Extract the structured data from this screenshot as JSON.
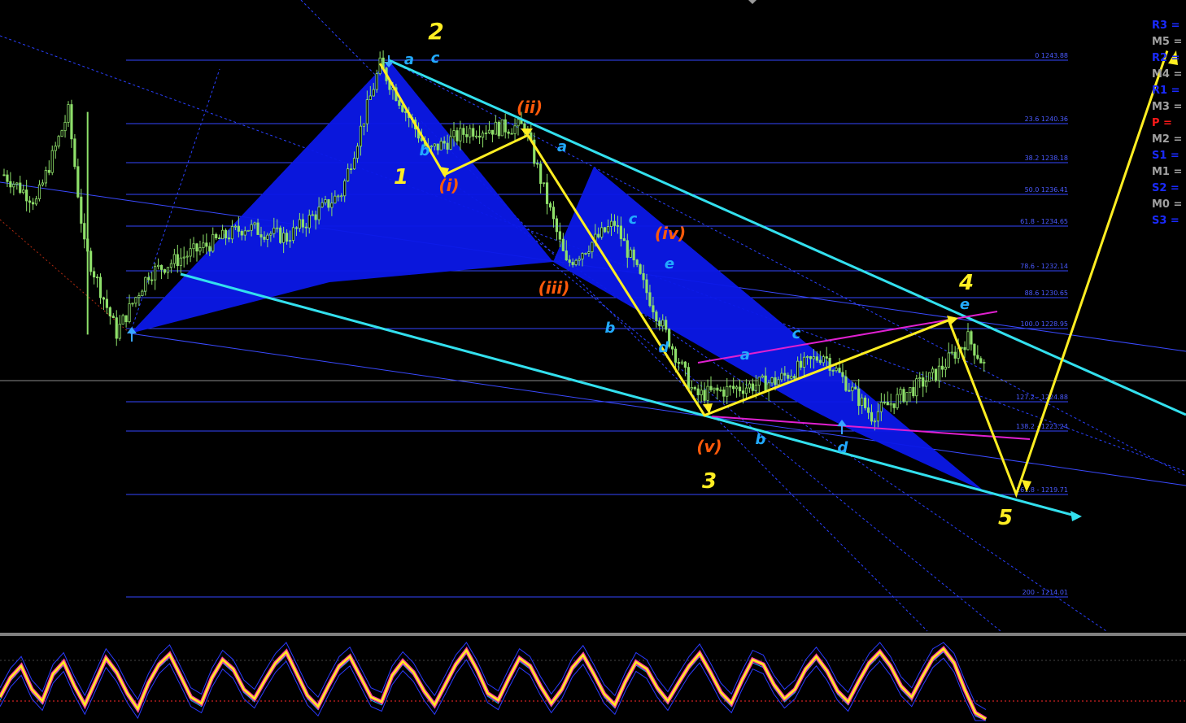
{
  "chart_data": {
    "type": "candlestick",
    "title": "",
    "xlabel": "",
    "ylabel": "",
    "ylim": [
      1211,
      1247
    ],
    "fib_levels": [
      {
        "label": "0 1243.88",
        "ratio": 0,
        "value": 1243.88
      },
      {
        "label": "23.6 1240.36",
        "ratio": 23.6,
        "value": 1240.36
      },
      {
        "label": "38.2 1238.18",
        "ratio": 38.2,
        "value": 1238.18
      },
      {
        "label": "50.0 1236.41",
        "ratio": 50.0,
        "value": 1236.41
      },
      {
        "label": "61.8 - 1234.65",
        "ratio": 61.8,
        "value": 1234.65
      },
      {
        "label": "78.6 - 1232.14",
        "ratio": 78.6,
        "value": 1232.14
      },
      {
        "label": "88.6 1230.65",
        "ratio": 88.6,
        "value": 1230.65
      },
      {
        "label": "100.0 1228.95",
        "ratio": 100.0,
        "value": 1228.95
      },
      {
        "label": "127.2 - 1224.88",
        "ratio": 127.2,
        "value": 1224.88
      },
      {
        "label": "138.2 - 1223.24",
        "ratio": 138.2,
        "value": 1223.24
      },
      {
        "label": "161.8 - 1219.71",
        "ratio": 161.8,
        "value": 1219.71
      },
      {
        "label": "200 - 1214.01",
        "ratio": 200,
        "value": 1214.01
      }
    ],
    "wave_labels": [
      {
        "text": "2",
        "color": "#ffee22"
      },
      {
        "text": "1",
        "color": "#ffee22"
      },
      {
        "text": "3",
        "color": "#ffee22"
      },
      {
        "text": "4",
        "color": "#ffee22"
      },
      {
        "text": "5",
        "color": "#ffee22"
      },
      {
        "text": "(i)",
        "color": "#ff5a0a"
      },
      {
        "text": "(ii)",
        "color": "#ff5a0a"
      },
      {
        "text": "(iii)",
        "color": "#ff5a0a"
      },
      {
        "text": "(iv)",
        "color": "#ff5a0a"
      },
      {
        "text": "(v)",
        "color": "#ff5a0a"
      },
      {
        "text": "a",
        "color": "#22aaff"
      },
      {
        "text": "c",
        "color": "#22aaff"
      },
      {
        "text": "b",
        "color": "#22aaff"
      },
      {
        "text": "a",
        "color": "#22aaff"
      },
      {
        "text": "c",
        "color": "#22aaff"
      },
      {
        "text": "e",
        "color": "#22aaff"
      },
      {
        "text": "b",
        "color": "#22aaff"
      },
      {
        "text": "d",
        "color": "#22aaff"
      },
      {
        "text": "a",
        "color": "#22aaff"
      },
      {
        "text": "c",
        "color": "#22aaff"
      },
      {
        "text": "b",
        "color": "#22aaff"
      },
      {
        "text": "d",
        "color": "#22aaff"
      },
      {
        "text": "e",
        "color": "#22aaff"
      }
    ],
    "pivot_levels": [
      {
        "label": "R3 =",
        "color": "#1a2aff"
      },
      {
        "label": "M5 =",
        "color": "#a0a0a0"
      },
      {
        "label": "R2 =",
        "color": "#1a2aff"
      },
      {
        "label": "M4 =",
        "color": "#a0a0a0"
      },
      {
        "label": "R1 =",
        "color": "#1a2aff"
      },
      {
        "label": "M3 =",
        "color": "#a0a0a0"
      },
      {
        "label": "P =",
        "color": "#ff1a1a"
      },
      {
        "label": "M2 =",
        "color": "#a0a0a0"
      },
      {
        "label": "S1 =",
        "color": "#1a2aff"
      },
      {
        "label": "M1 =",
        "color": "#a0a0a0"
      },
      {
        "label": "S2 =",
        "color": "#1a2aff"
      },
      {
        "label": "M0 =",
        "color": "#a0a0a0"
      },
      {
        "label": "S3 =",
        "color": "#1a2aff"
      }
    ],
    "price_path": [
      {
        "t": 0,
        "v": 1237.5
      },
      {
        "t": 10,
        "v": 1236.0
      },
      {
        "t": 20,
        "v": 1241.0
      },
      {
        "t": 25,
        "v": 1233.5
      },
      {
        "t": 35,
        "v": 1228.7
      },
      {
        "t": 45,
        "v": 1232.0
      },
      {
        "t": 60,
        "v": 1233.3
      },
      {
        "t": 75,
        "v": 1234.6
      },
      {
        "t": 88,
        "v": 1234.0
      },
      {
        "t": 105,
        "v": 1236.5
      },
      {
        "t": 117,
        "v": 1243.6
      },
      {
        "t": 132,
        "v": 1238.8
      },
      {
        "t": 145,
        "v": 1240.0
      },
      {
        "t": 162,
        "v": 1240.2
      },
      {
        "t": 175,
        "v": 1232.5
      },
      {
        "t": 190,
        "v": 1234.8
      },
      {
        "t": 215,
        "v": 1225.2
      },
      {
        "t": 240,
        "v": 1226.0
      },
      {
        "t": 255,
        "v": 1227.5
      },
      {
        "t": 270,
        "v": 1224.1
      },
      {
        "t": 290,
        "v": 1226.4
      },
      {
        "t": 300,
        "v": 1228.4
      },
      {
        "t": 305,
        "v": 1226.9
      }
    ],
    "projected_wave": [
      {
        "t": 117,
        "v": 1243.7
      },
      {
        "t": 137,
        "v": 1237.5
      },
      {
        "t": 163,
        "v": 1239.7
      },
      {
        "t": 218,
        "v": 1224.1
      },
      {
        "t": 294,
        "v": 1229.4
      },
      {
        "t": 315,
        "v": 1219.7
      },
      {
        "t": 362,
        "v": 1244.4
      }
    ],
    "oscillator": {
      "values": [
        30,
        55,
        70,
        40,
        25,
        60,
        75,
        45,
        20,
        50,
        80,
        62,
        35,
        15,
        48,
        72,
        85,
        58,
        30,
        22,
        55,
        78,
        66,
        40,
        28,
        52,
        74,
        88,
        60,
        32,
        18,
        45,
        70,
        82,
        56,
        30,
        24,
        58,
        76,
        62,
        38,
        20,
        46,
        72,
        90,
        65,
        35,
        26,
        54,
        80,
        70,
        44,
        22,
        40,
        68,
        84,
        60,
        34,
        20,
        50,
        75,
        66,
        42,
        25,
        48,
        70,
        86,
        62,
        36,
        22,
        52,
        78,
        72,
        46,
        28,
        40,
        66,
        82,
        64,
        38,
        24,
        50,
        74,
        88,
        70,
        44,
        30,
        56,
        80,
        92,
        74,
        40,
        10,
        2
      ]
    }
  }
}
